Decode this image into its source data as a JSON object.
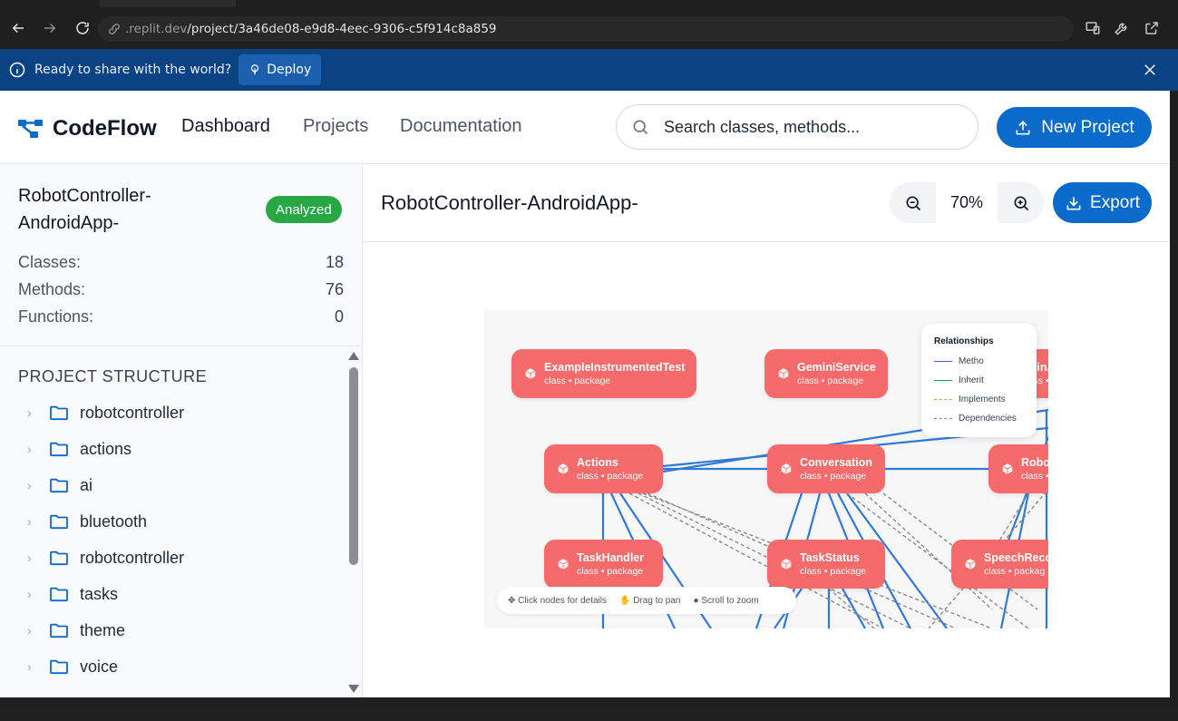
{
  "browser": {
    "url_host": ".replit.dev",
    "url_path": "/project/3a46de08-e9d8-4eec-9306-c5f914c8a859"
  },
  "banner": {
    "text": "Ready to share with the world?",
    "deploy_label": "Deploy"
  },
  "header": {
    "logo": "CodeFlow",
    "nav": [
      "Dashboard",
      "Projects",
      "Documentation"
    ],
    "search_placeholder": "Search classes, methods...",
    "new_project_label": "New Project"
  },
  "sidebar": {
    "project_name": "RobotController-AndroidApp-",
    "status_badge": "Analyzed",
    "stats": [
      {
        "label": "Classes:",
        "value": "18"
      },
      {
        "label": "Methods:",
        "value": "76"
      },
      {
        "label": "Functions:",
        "value": "0"
      }
    ],
    "structure_title": "PROJECT STRUCTURE",
    "folders": [
      "robotcontroller",
      "actions",
      "ai",
      "bluetooth",
      "robotcontroller",
      "tasks",
      "theme",
      "voice"
    ]
  },
  "main": {
    "title": "RobotController-AndroidApp-",
    "zoom_level": "70%",
    "export_label": "Export"
  },
  "diagram": {
    "nodes": [
      {
        "name": "ExampleInstrumentedTest",
        "sub": "class • package"
      },
      {
        "name": "GeminiService",
        "sub": "class • package"
      },
      {
        "name": "MainA",
        "sub": "class •"
      },
      {
        "name": "Actions",
        "sub": "class • package"
      },
      {
        "name": "Conversation",
        "sub": "class • package"
      },
      {
        "name": "Robot",
        "sub": "class •"
      },
      {
        "name": "TaskHandler",
        "sub": "class • package"
      },
      {
        "name": "TaskStatus",
        "sub": "class • package"
      },
      {
        "name": "SpeechReco",
        "sub": "class • packag"
      }
    ],
    "legend": {
      "title": "Relationships",
      "items": [
        {
          "label": "Metho",
          "color": "#2f6fd6",
          "style": "solid"
        },
        {
          "label": "Inherit",
          "color": "#22a33a",
          "style": "solid"
        },
        {
          "label": "Implements",
          "color": "#f08c2e",
          "style": "dashed"
        },
        {
          "label": "Dependencies",
          "color": "#888888",
          "style": "dashed"
        }
      ]
    },
    "hints": [
      "Click nodes for details",
      "Drag to pan",
      "Scroll to zoom"
    ]
  }
}
